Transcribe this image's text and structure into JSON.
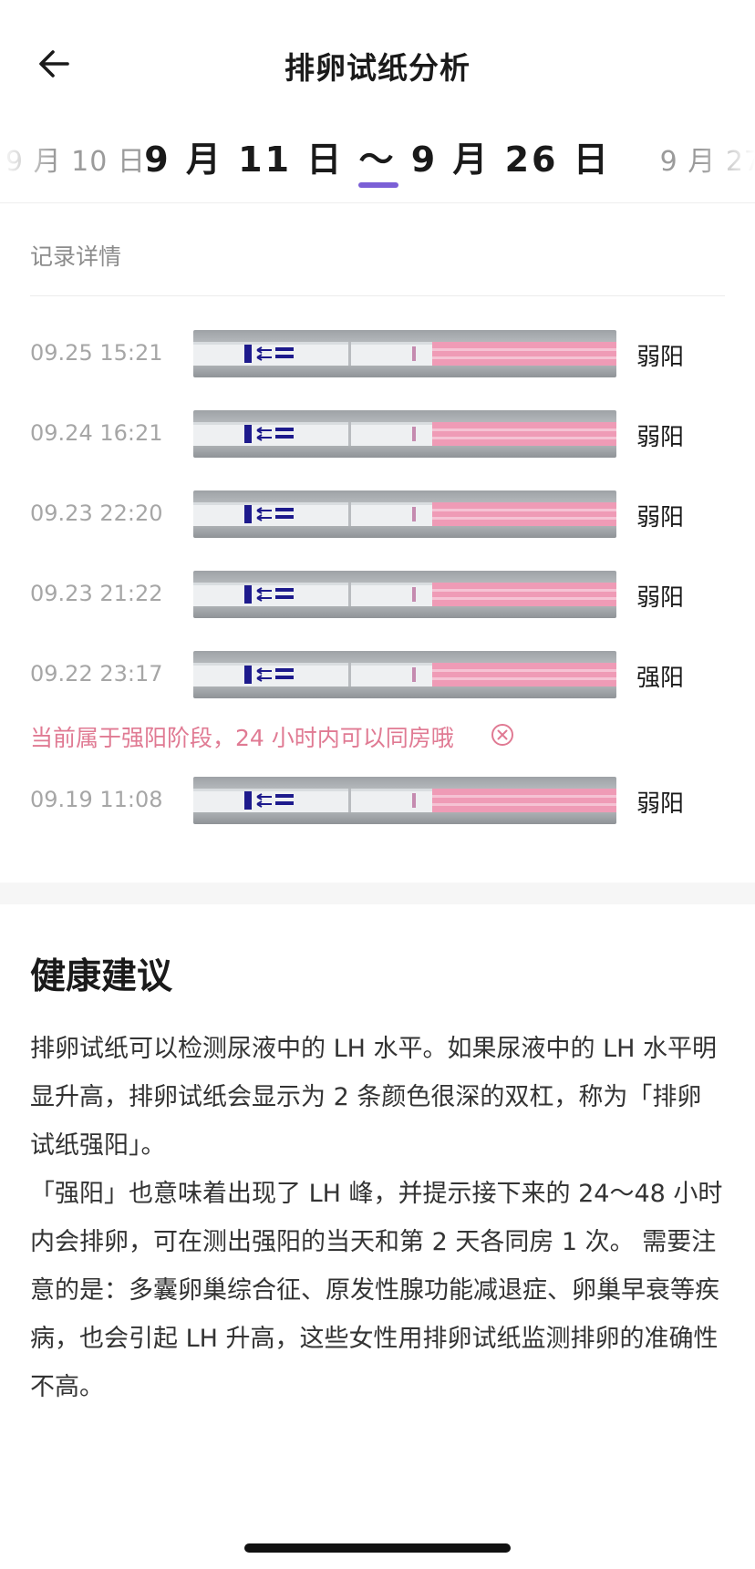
{
  "header": {
    "title": "排卵试纸分析",
    "back_icon": "arrow-left-icon"
  },
  "date_selector": {
    "prev_range": "9 月 10 日",
    "current_range": "9 月 11 日 ～ 9 月 26 日",
    "next_range": "9 月 27",
    "accent_color": "#7b5fd6"
  },
  "records_section": {
    "label": "记录详情",
    "records": [
      {
        "time": "09.25 15:21",
        "result": "弱阳",
        "strip_image": "test-strip-photo"
      },
      {
        "time": "09.24 16:21",
        "result": "弱阳",
        "strip_image": "test-strip-photo"
      },
      {
        "time": "09.23 22:20",
        "result": "弱阳",
        "strip_image": "test-strip-photo"
      },
      {
        "time": "09.23 21:22",
        "result": "弱阳",
        "strip_image": "test-strip-photo"
      },
      {
        "time": "09.22 23:17",
        "result": "强阳",
        "strip_image": "test-strip-photo"
      },
      {
        "time": "09.19 11:08",
        "result": "弱阳",
        "strip_image": "test-strip-photo"
      }
    ],
    "strong_positive_tip": "当前属于强阳阶段，24 小时内可以同房哦",
    "tip_color": "#e07a93",
    "tip_close_icon": "circle-close-icon"
  },
  "advice": {
    "title": "健康建议",
    "paragraph_1": "排卵试纸可以检测尿液中的 LH 水平。如果尿液中的 LH 水平明显升高，排卵试纸会显示为 2 条颜色很深的双杠，称为「排卵试纸强阳」。",
    "paragraph_2": "「强阳」也意味着出现了 LH 峰，并提示接下来的 24～48 小时内会排卵，可在测出强阳的当天和第 2 天各同房 1 次。 需要注意的是：多囊卵巢综合征、原发性腺功能减退症、卵巢早衰等疾病，也会引起 LH 升高，这些女性用排卵试纸监测排卵的准确性不高。"
  }
}
